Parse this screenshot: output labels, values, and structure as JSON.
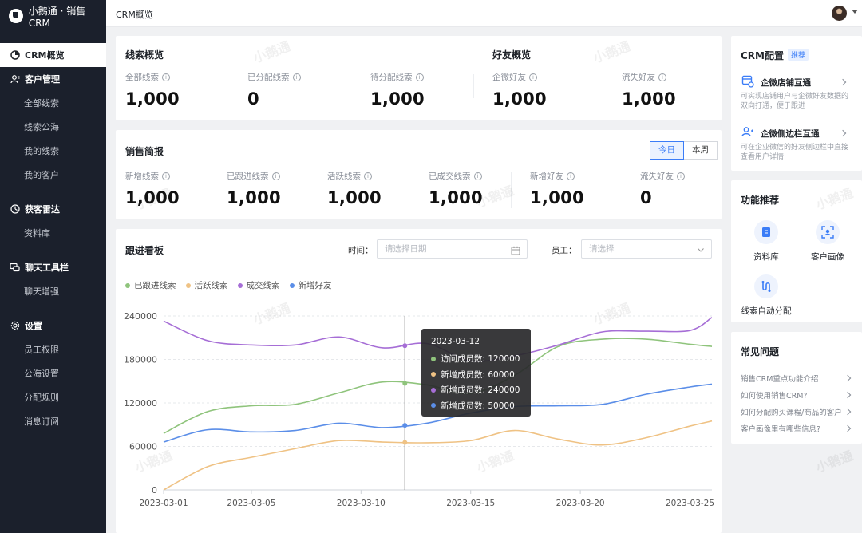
{
  "app": {
    "brand": "小鹅通 · 销售CRM",
    "page_title": "CRM概览"
  },
  "sidebar": {
    "overview": "CRM概览",
    "groups": [
      {
        "label": "客户管理",
        "items": [
          "全部线索",
          "线索公海",
          "我的线索",
          "我的客户"
        ]
      },
      {
        "label": "获客雷达",
        "items": [
          "资料库"
        ]
      },
      {
        "label": "聊天工具栏",
        "items": [
          "聊天增强"
        ]
      },
      {
        "label": "设置",
        "items": [
          "员工权限",
          "公海设置",
          "分配规则",
          "消息订阅"
        ]
      }
    ]
  },
  "leads_overview": {
    "title": "线索概览",
    "stats": [
      {
        "label": "全部线索",
        "value": "1,000"
      },
      {
        "label": "已分配线索",
        "value": "0"
      },
      {
        "label": "待分配线索",
        "value": "1,000"
      }
    ]
  },
  "friends_overview": {
    "title": "好友概览",
    "stats": [
      {
        "label": "企微好友",
        "value": "1,000"
      },
      {
        "label": "流失好友",
        "value": "1,000"
      }
    ]
  },
  "sales_brief": {
    "title": "销售简报",
    "toggle": [
      "今日",
      "本周"
    ],
    "stats": [
      {
        "label": "新增线索",
        "value": "1,000"
      },
      {
        "label": "已跟进线索",
        "value": "1,000"
      },
      {
        "label": "活跃线索",
        "value": "1,000"
      },
      {
        "label": "已成交线索",
        "value": "1,000"
      },
      {
        "label": "新增好友",
        "value": "1,000"
      },
      {
        "label": "流失好友",
        "value": "0"
      }
    ]
  },
  "board": {
    "title": "跟进看板",
    "time_label": "时间：",
    "date_placeholder": "请选择日期",
    "staff_label": "员工：",
    "staff_placeholder": "请选择"
  },
  "chart_data": {
    "type": "line",
    "x": [
      "2023-03-01",
      "2023-03-03",
      "2023-03-05",
      "2023-03-07",
      "2023-03-09",
      "2023-03-11",
      "2023-03-13",
      "2023-03-15",
      "2023-03-17",
      "2023-03-19",
      "2023-03-21",
      "2023-03-23",
      "2023-03-25",
      "2023-03-26"
    ],
    "x_ticks": [
      "2023-03-01",
      "2023-03-05",
      "2023-03-10",
      "2023-03-15",
      "2023-03-20",
      "2023-03-25"
    ],
    "y_ticks": [
      "0",
      "60000",
      "120000",
      "180000",
      "240000"
    ],
    "ylim": [
      0,
      240000
    ],
    "grid": true,
    "legend_position": "top-left",
    "series": [
      {
        "name": "已跟进线索",
        "color": "#8fc47c",
        "values": [
          78000,
          108000,
          116000,
          118000,
          134000,
          149000,
          145000,
          133000,
          158000,
          198000,
          208000,
          208000,
          201000,
          198000
        ]
      },
      {
        "name": "活跃线索",
        "color": "#efc284",
        "values": [
          0,
          32000,
          45000,
          57000,
          68000,
          66000,
          65000,
          68000,
          82000,
          70000,
          62000,
          72000,
          88000,
          95000
        ]
      },
      {
        "name": "成交线索",
        "color": "#a66ed6",
        "values": [
          233000,
          206000,
          200000,
          200000,
          211000,
          196000,
          202000,
          178000,
          185000,
          200000,
          218000,
          219000,
          220000,
          238000
        ]
      },
      {
        "name": "新增好友",
        "color": "#5b8ee8",
        "values": [
          66000,
          83000,
          80000,
          82000,
          92000,
          86000,
          92000,
          106000,
          115000,
          116000,
          118000,
          132000,
          142000,
          146000
        ]
      }
    ],
    "tooltip": {
      "date": "2023-03-12",
      "rows": [
        {
          "label": "访问成员数: 120000",
          "color": "#8fc47c"
        },
        {
          "label": "新增成员数: 60000",
          "color": "#efc284"
        },
        {
          "label": "新增成员数: 240000",
          "color": "#a66ed6"
        },
        {
          "label": "新增成员数: 50000",
          "color": "#5b8ee8"
        }
      ]
    }
  },
  "crm_config": {
    "title": "CRM配置",
    "badge": "推荐",
    "items": [
      {
        "name": "企微店铺互通",
        "desc": "可实现店铺用户与企微好友数据的双向打通，便于跟进"
      },
      {
        "name": "企微侧边栏互通",
        "desc": "可在企业微信的好友侧边栏中直接查看用户详情"
      }
    ]
  },
  "features": {
    "title": "功能推荐",
    "items": [
      "资料库",
      "客户画像",
      "线索自动分配"
    ]
  },
  "faq": {
    "title": "常见问题",
    "items": [
      "销售CRM重点功能介绍",
      "如何使用销售CRM?",
      "如何分配购买课程/商品的客户",
      "客户画像里有哪些信息?"
    ]
  },
  "watermark": "小鹅通"
}
